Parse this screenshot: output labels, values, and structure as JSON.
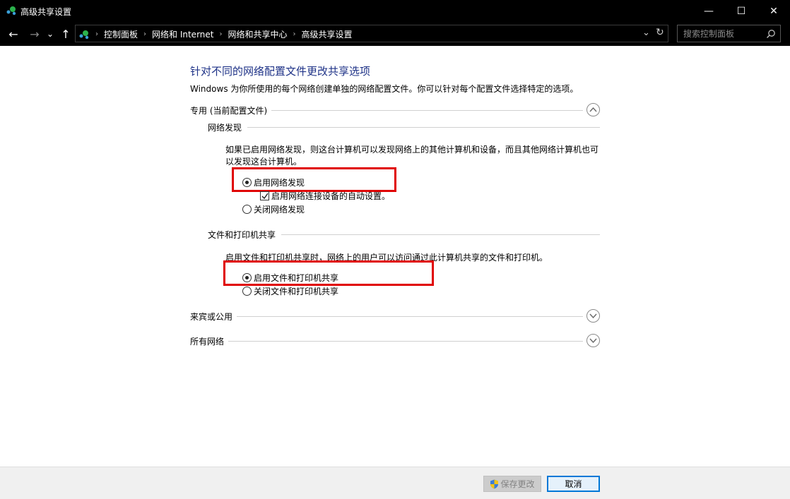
{
  "window": {
    "title": "高级共享设置",
    "minimize_glyph": "—",
    "maximize_glyph": "☐",
    "close_glyph": "✕"
  },
  "nav": {
    "back_glyph": "←",
    "forward_glyph": "→",
    "recent_glyph": "⌄",
    "up_glyph": "↑",
    "breadcrumb": [
      "控制面板",
      "网络和 Internet",
      "网络和共享中心",
      "高级共享设置"
    ],
    "separator": "›",
    "dropdown_glyph": "⌄",
    "refresh_glyph": "↻",
    "search_placeholder": "搜索控制面板"
  },
  "main": {
    "heading": "针对不同的网络配置文件更改共享选项",
    "description": "Windows 为你所使用的每个网络创建单独的网络配置文件。你可以针对每个配置文件选择特定的选项。",
    "private_profile": {
      "label": "专用 (当前配置文件)",
      "expanded": true,
      "network_discovery": {
        "label": "网络发现",
        "description": "如果已启用网络发现，则这台计算机可以发现网络上的其他计算机和设备，而且其他网络计算机也可以发现这台计算机。",
        "turn_on": "启用网络发现",
        "turn_on_selected": true,
        "auto_setup": "启用网络连接设备的自动设置。",
        "auto_setup_checked": true,
        "turn_off": "关闭网络发现"
      },
      "file_printer_sharing": {
        "label": "文件和打印机共享",
        "description": "启用文件和打印机共享时，网络上的用户可以访问通过此计算机共享的文件和打印机。",
        "turn_on": "启用文件和打印机共享",
        "turn_on_selected": true,
        "turn_off": "关闭文件和打印机共享"
      }
    },
    "guest_public": {
      "label": "来宾或公用",
      "expanded": false
    },
    "all_networks": {
      "label": "所有网络",
      "expanded": false
    }
  },
  "footer": {
    "save_label": "保存更改",
    "cancel_label": "取消"
  },
  "colors": {
    "heading": "#1e3287",
    "highlight_box": "#e00000",
    "titlebar": "#000000"
  }
}
